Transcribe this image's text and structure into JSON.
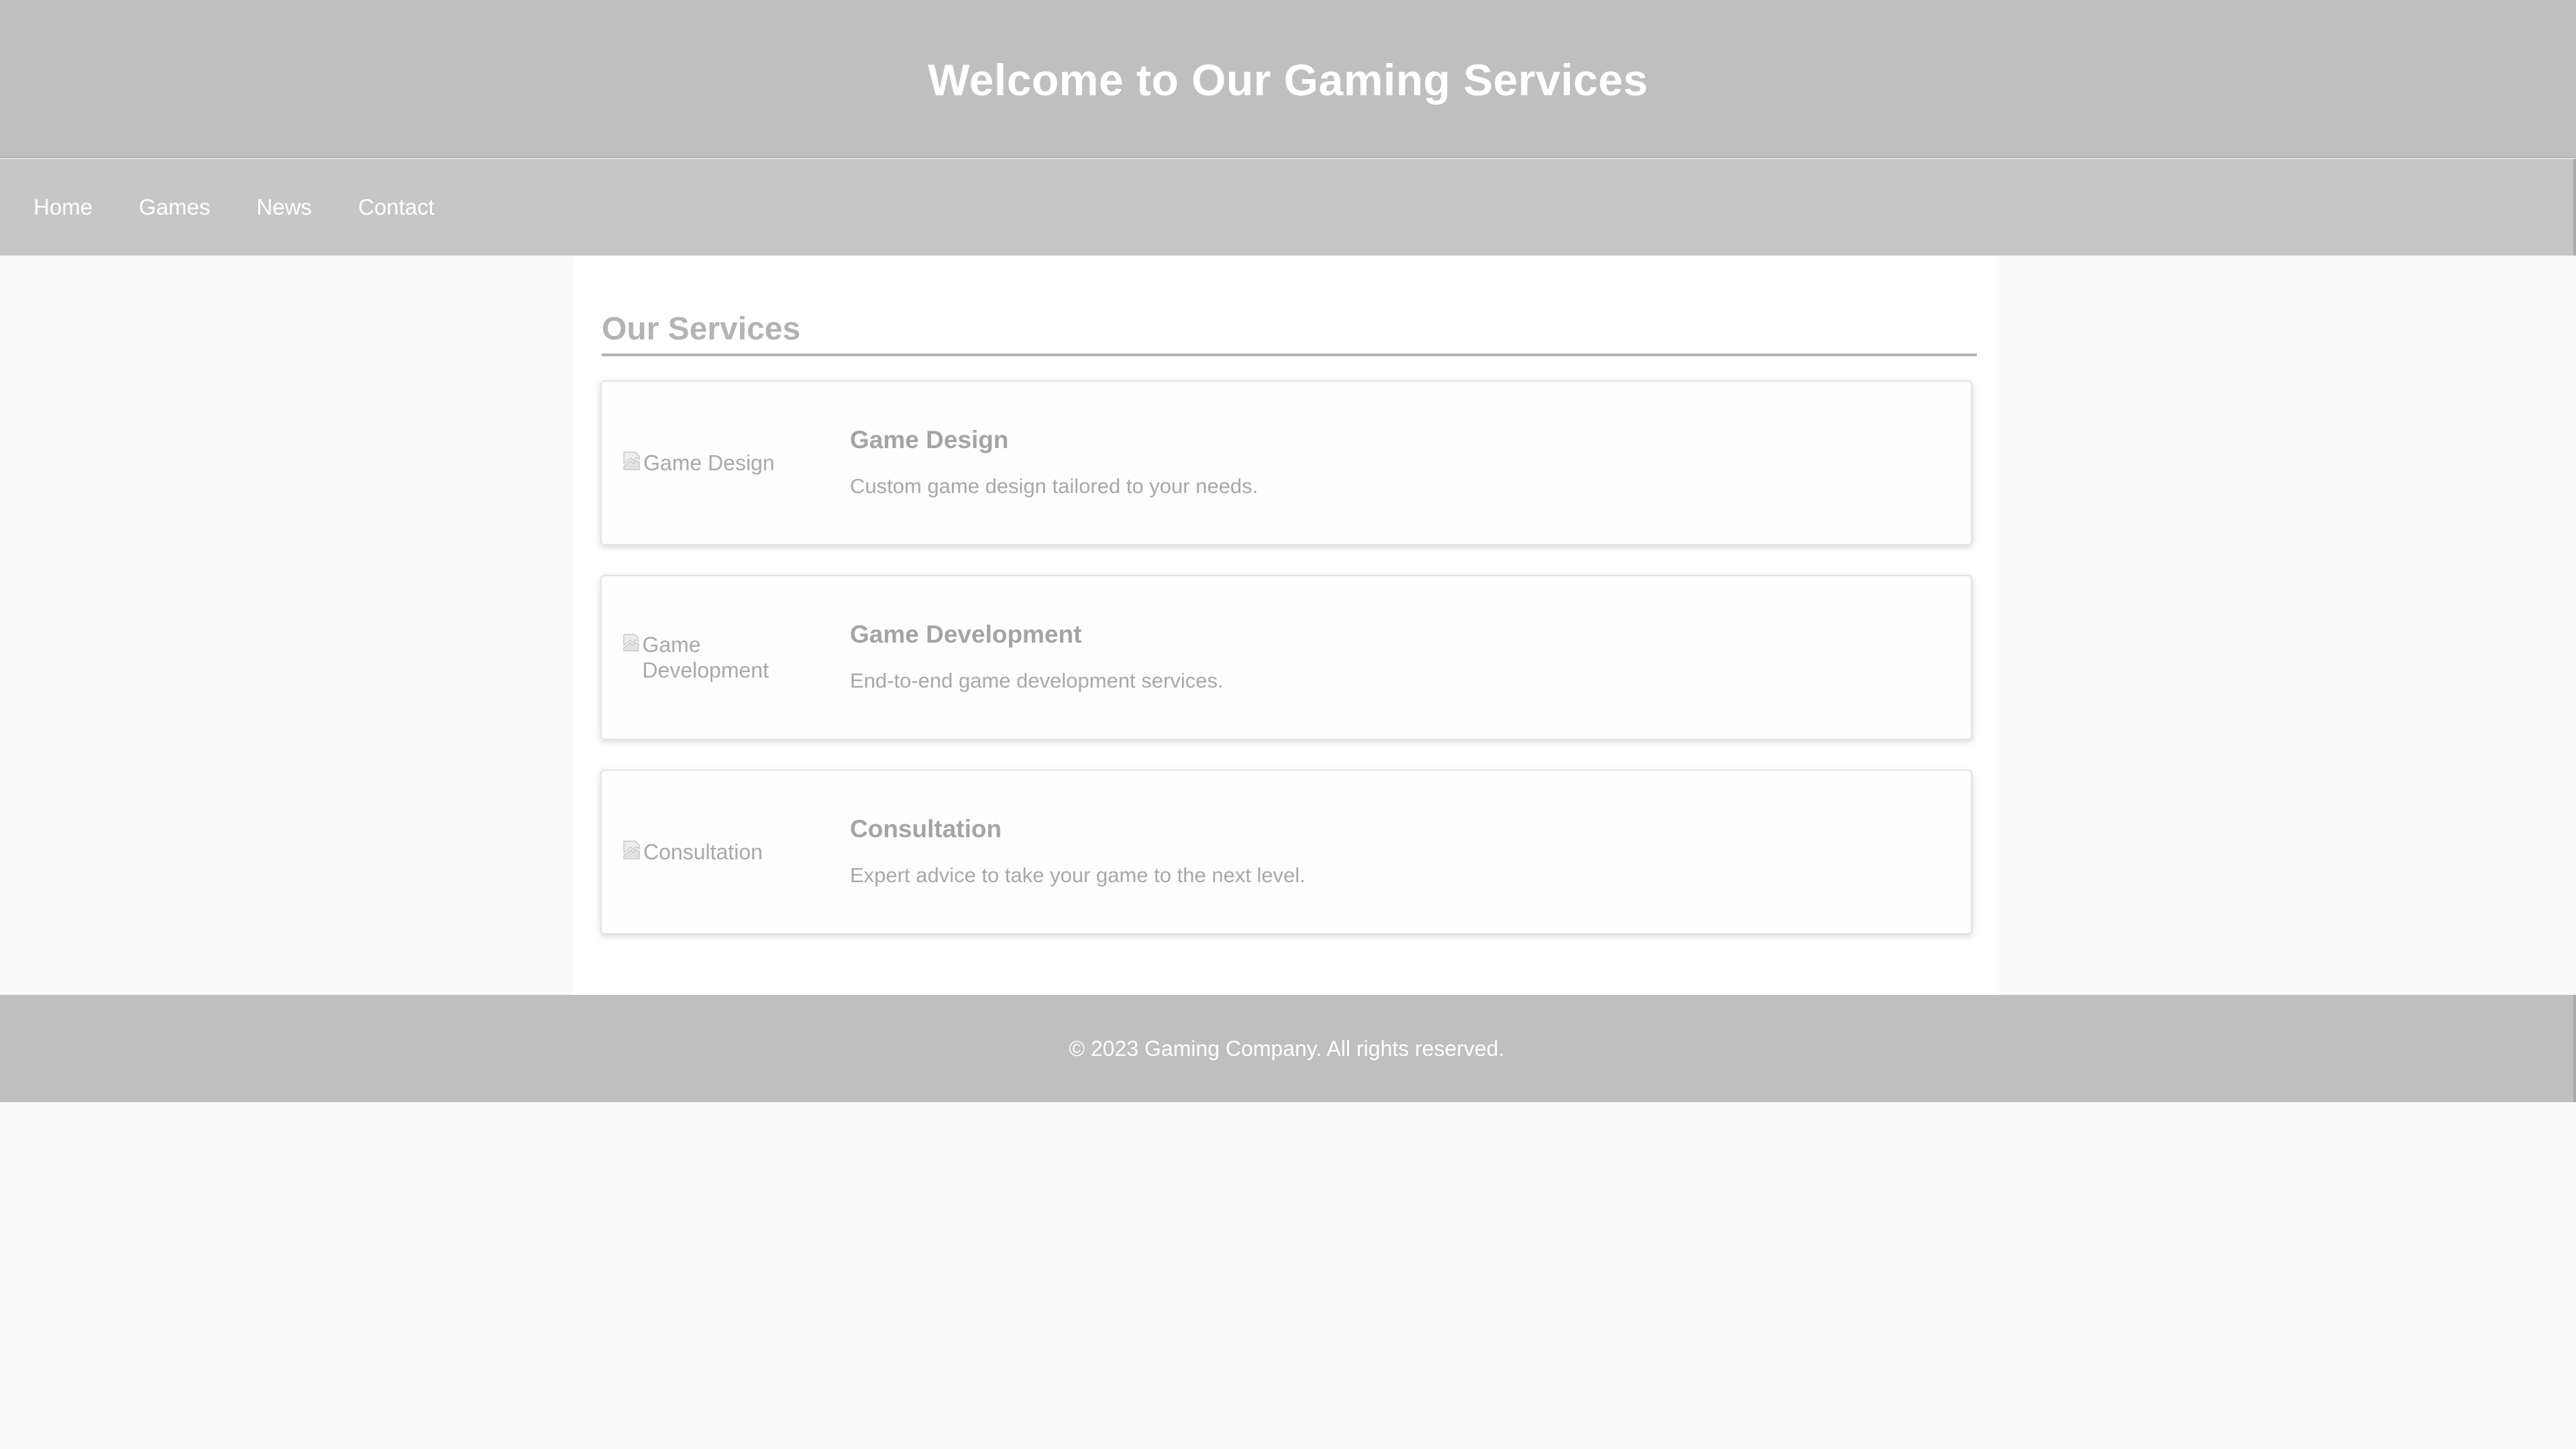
{
  "header": {
    "title": "Welcome to Our Gaming Services"
  },
  "nav": {
    "items": [
      {
        "label": "Home"
      },
      {
        "label": "Games"
      },
      {
        "label": "News"
      },
      {
        "label": "Contact"
      }
    ]
  },
  "main": {
    "section_title": "Our Services",
    "services": [
      {
        "image_alt": "Game Design",
        "title": "Game Design",
        "description": "Custom game design tailored to your needs."
      },
      {
        "image_alt": "Game Development",
        "title": "Game Development",
        "description": "End-to-end game development services."
      },
      {
        "image_alt": "Consultation",
        "title": "Consultation",
        "description": "Expert advice to take your game to the next level."
      }
    ]
  },
  "footer": {
    "text": "© 2023 Gaming Company. All rights reserved."
  },
  "colors": {
    "header_bg": "#bfbfbf",
    "nav_bg": "#c6c6c6",
    "page_bg": "#fafafa",
    "card_bg": "#fdfdfd",
    "text_muted": "#a8a8a8",
    "heading_text": "#ffffff"
  },
  "icons": {
    "broken_image": "broken-image-icon"
  }
}
